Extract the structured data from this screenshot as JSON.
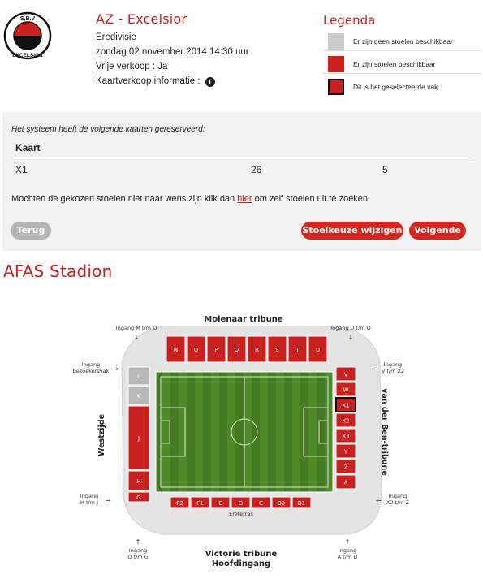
{
  "club": {
    "logo_text": "S.B.V. EXCELSIOR",
    "logo_top": "S.B.V",
    "logo_bottom": "EXCELSIOR"
  },
  "match": {
    "title": "AZ - Excelsior",
    "competition": "Eredivisie",
    "datetime": "zondag 02 november 2014 14:30 uur",
    "sale": "Vrije verkoop : Ja",
    "info_label": "Kaartverkoop informatie :"
  },
  "legend": {
    "title": "Legenda",
    "items": [
      {
        "label": "Er zijn geen stoelen beschikbaar",
        "color": "#cccccc"
      },
      {
        "label": "Er zijn stoelen beschikbaar",
        "color": "#c8211f"
      },
      {
        "label": "Dit is het geselecteerde vak",
        "color": "#c8211f"
      }
    ]
  },
  "reservation": {
    "intro": "Het systeem heeft de volgende kaarten gereserveerd:",
    "header": "Kaart",
    "rows": [
      {
        "section": "X1",
        "row": "26",
        "seat": "5"
      }
    ],
    "note_before": "Mochten de gekozen stoelen niet naar wens zijn klik dan ",
    "note_link": "hier",
    "note_after": " om zelf stoelen uit te zoeken."
  },
  "buttons": {
    "back": "Terug",
    "change": "Stoelkeuze wijzigen",
    "next": "Volgende"
  },
  "stadium": {
    "title": "AFAS Stadion",
    "tribunes": {
      "north": "Molenaar tribune",
      "east": "van der Ben-tribune",
      "west": "Westzijde",
      "south_1": "Victorie tribune",
      "south_2": "Hoofdingang",
      "erasterras": "Ereterras"
    },
    "entrances": [
      {
        "l1": "Ingang M t/m Q",
        "l2": ""
      },
      {
        "l1": "Ingang U t/m Q",
        "l2": ""
      },
      {
        "l1": "Ingang",
        "l2": "bezoekersvak"
      },
      {
        "l1": "Ingang",
        "l2": "V t/m X2"
      },
      {
        "l1": "Ingang",
        "l2": "H t/m J"
      },
      {
        "l1": "Ingang",
        "l2": "X2 t/m Z"
      },
      {
        "l1": "Ingang",
        "l2": "O t/m G"
      },
      {
        "l1": "Ingang",
        "l2": "A t/m D"
      }
    ],
    "sections_north": [
      "N",
      "O",
      "P",
      "Q",
      "R",
      "S",
      "T",
      "U"
    ],
    "sections_east": [
      "V",
      "W",
      "X1",
      "X2",
      "X3",
      "Y",
      "Z",
      "A"
    ],
    "sections_west": [
      "L",
      "K",
      "J",
      "H",
      "G"
    ],
    "sections_south": [
      "F2",
      "F1",
      "E",
      "D",
      "C",
      "B2",
      "B1"
    ],
    "selected": "X1",
    "colors": {
      "available": "#c8211f",
      "unavailable": "#b9b9b9",
      "pitch": "#4f8a2a",
      "pitch_dark": "#437a22"
    }
  }
}
